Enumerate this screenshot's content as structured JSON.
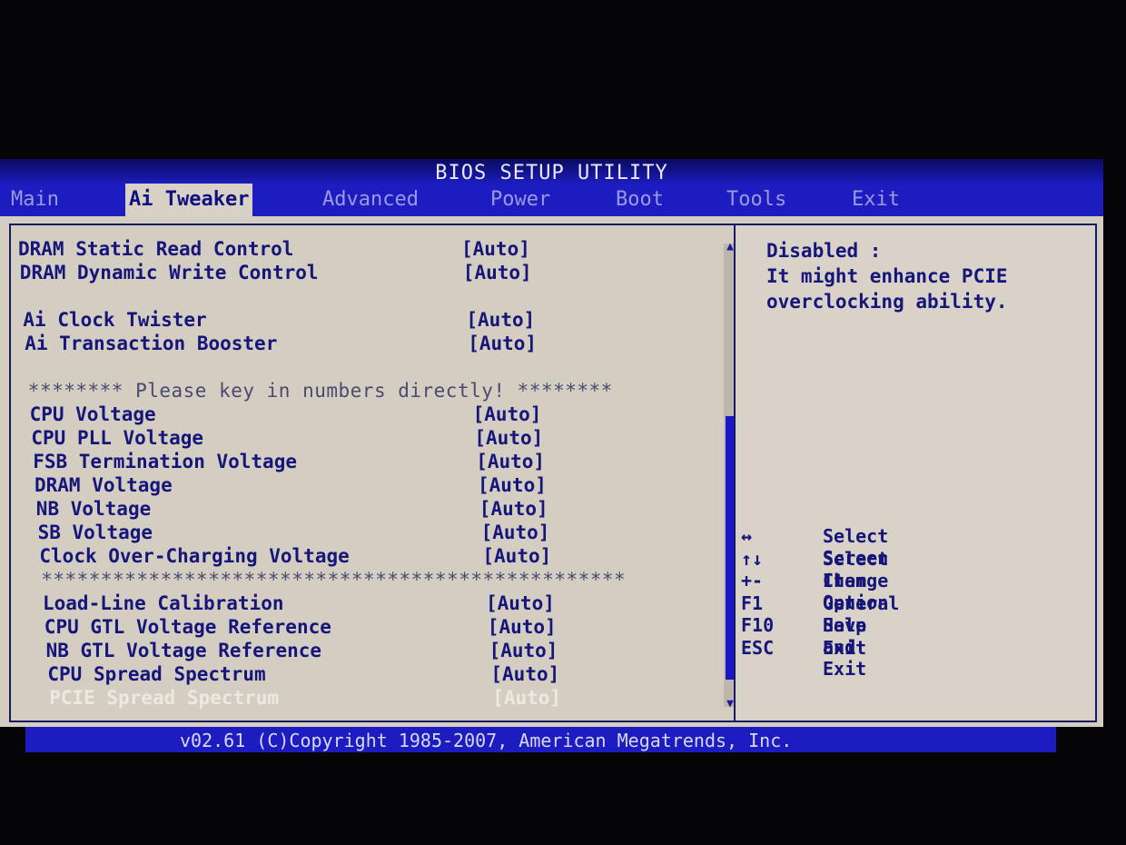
{
  "title": "BIOS SETUP UTILITY",
  "tabs": [
    {
      "label": "Main",
      "active": false
    },
    {
      "label": "Ai Tweaker",
      "active": true
    },
    {
      "label": "Advanced",
      "active": false
    },
    {
      "label": "Power",
      "active": false
    },
    {
      "label": "Boot",
      "active": false
    },
    {
      "label": "Tools",
      "active": false
    },
    {
      "label": "Exit",
      "active": false
    }
  ],
  "settings": [
    {
      "type": "item",
      "label": "DRAM Static Read Control",
      "value": "[Auto]"
    },
    {
      "type": "item",
      "label": "DRAM Dynamic Write Control",
      "value": "[Auto]"
    },
    {
      "type": "blank"
    },
    {
      "type": "item",
      "label": "Ai Clock Twister",
      "value": "[Auto]"
    },
    {
      "type": "item",
      "label": "Ai Transaction Booster",
      "value": "[Auto]"
    },
    {
      "type": "blank"
    },
    {
      "type": "sep",
      "label": "******** Please key in numbers directly! ********"
    },
    {
      "type": "item",
      "label": "CPU Voltage",
      "value": "[Auto]"
    },
    {
      "type": "item",
      "label": "CPU PLL Voltage",
      "value": "[Auto]"
    },
    {
      "type": "item",
      "label": "FSB Termination Voltage",
      "value": "[Auto]"
    },
    {
      "type": "item",
      "label": "DRAM Voltage",
      "value": "[Auto]"
    },
    {
      "type": "item",
      "label": "NB Voltage",
      "value": "[Auto]"
    },
    {
      "type": "item",
      "label": "SB Voltage",
      "value": "[Auto]"
    },
    {
      "type": "item",
      "label": "Clock Over-Charging Voltage",
      "value": "[Auto]"
    },
    {
      "type": "sep",
      "label": "*************************************************"
    },
    {
      "type": "item",
      "label": "Load-Line Calibration",
      "value": "[Auto]"
    },
    {
      "type": "item",
      "label": "CPU GTL Voltage Reference",
      "value": "[Auto]"
    },
    {
      "type": "item",
      "label": "NB GTL Voltage Reference",
      "value": "[Auto]"
    },
    {
      "type": "item",
      "label": "CPU Spread Spectrum",
      "value": "[Auto]"
    },
    {
      "type": "item",
      "label": "PCIE Spread Spectrum",
      "value": "[Auto]",
      "selected": true
    }
  ],
  "scrollbar": {
    "up_icon": "triangle-up",
    "down_icon": "triangle-down",
    "up": "▲",
    "down": "▼"
  },
  "help": {
    "text": "Disabled :\nIt might enhance PCIE\noverclocking ability."
  },
  "keys": [
    {
      "key": "↔",
      "desc": "Select Screen"
    },
    {
      "key": "↑↓",
      "desc": "Select Item"
    },
    {
      "key": "+-",
      "desc": "Change Option"
    },
    {
      "key": "F1",
      "desc": "General Help"
    },
    {
      "key": "F10",
      "desc": "Save and Exit"
    },
    {
      "key": "ESC",
      "desc": "Exit"
    }
  ],
  "footer": "v02.61 (C)Copyright 1985-2007, American Megatrends, Inc.",
  "colors": {
    "blue": "#1c1cc0",
    "panel": "#d4cdc2",
    "text": "#16167a",
    "selected": "#ece8e2"
  }
}
